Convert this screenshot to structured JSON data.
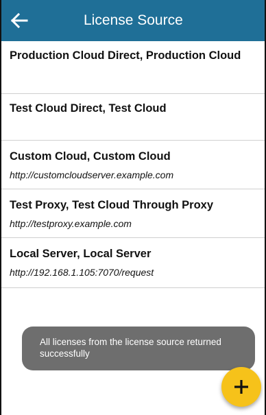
{
  "appbar": {
    "title": "License Source",
    "back_icon": "arrow-left-icon",
    "background_color": "#1f6f97"
  },
  "list": {
    "items": [
      {
        "title": "Production Cloud Direct, Production Cloud",
        "subtitle": ""
      },
      {
        "title": "Test Cloud Direct, Test Cloud",
        "subtitle": ""
      },
      {
        "title": "Custom Cloud, Custom Cloud",
        "subtitle": "http://customcloudserver.example.com"
      },
      {
        "title": "Test Proxy, Test Cloud Through Proxy",
        "subtitle": "http://testproxy.example.com"
      },
      {
        "title": "Local Server, Local Server",
        "subtitle": "http://192.168.1.105:7070/request"
      }
    ]
  },
  "toast": {
    "message": "All licenses from the license source returned successfully"
  },
  "fab": {
    "icon": "plus-icon",
    "color": "#f6c21a"
  }
}
